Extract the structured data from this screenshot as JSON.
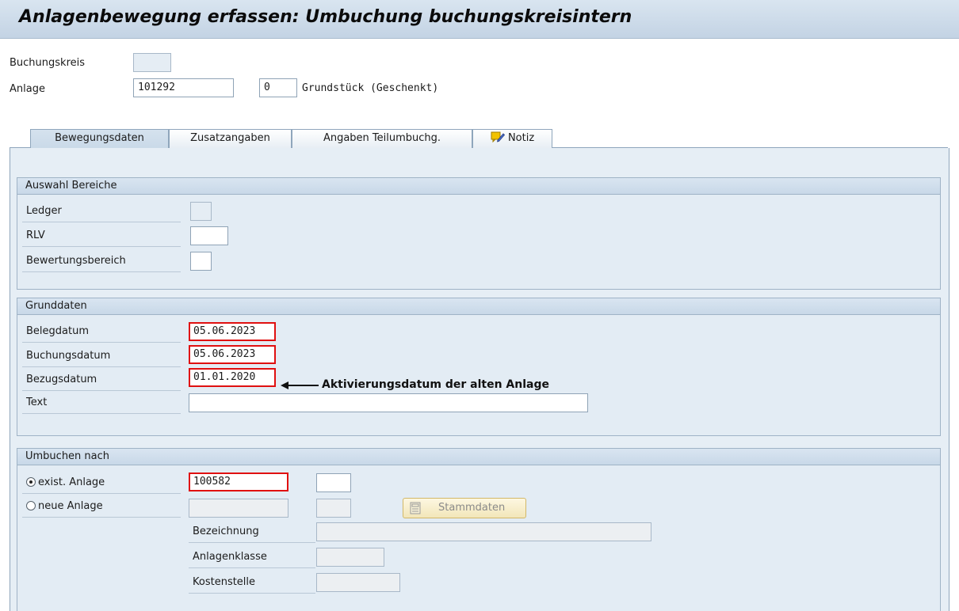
{
  "window": {
    "title": "Anlagenbewegung erfassen: Umbuchung buchungskreisintern"
  },
  "header": {
    "buchungskreis_label": "Buchungskreis",
    "buchungskreis_value": "",
    "anlage_label": "Anlage",
    "anlage_value": "101292",
    "unternummer_value": "0",
    "anlage_description": "Grundstück (Geschenkt)"
  },
  "tabs": [
    {
      "label": "Bewegungsdaten",
      "active": true
    },
    {
      "label": "Zusatzangaben",
      "active": false
    },
    {
      "label": "Angaben Teilumbuchg.",
      "active": false
    },
    {
      "label": "Notiz",
      "active": false,
      "icon": "note-pencil-icon"
    }
  ],
  "auswahl": {
    "title": "Auswahl Bereiche",
    "ledger_label": "Ledger",
    "ledger_value": "",
    "rlv_label": "RLV",
    "rlv_value": "",
    "bewertungsbereich_label": "Bewertungsbereich",
    "bewertungsbereich_value": ""
  },
  "grunddaten": {
    "title": "Grunddaten",
    "belegdatum_label": "Belegdatum",
    "belegdatum_value": "05.06.2023",
    "buchungsdatum_label": "Buchungsdatum",
    "buchungsdatum_value": "05.06.2023",
    "bezugsdatum_label": "Bezugsdatum",
    "bezugsdatum_value": "01.01.2020",
    "text_label": "Text",
    "text_value": ""
  },
  "annotation": {
    "text": "Aktivierungsdatum der alten Anlage"
  },
  "umbuchen": {
    "title": "Umbuchen nach",
    "exist_label": "exist. Anlage",
    "exist_selected": true,
    "exist_anlage_value": "100582",
    "exist_sub_value": "",
    "neue_label": "neue Anlage",
    "neue_selected": false,
    "stammdaten_button": "Stammdaten",
    "bezeichnung_label": "Bezeichnung",
    "anlagenklasse_label": "Anlagenklasse",
    "kostenstelle_label": "Kostenstelle"
  },
  "colors": {
    "highlight_border": "#e01010",
    "panel_bg": "#e6eef5"
  }
}
